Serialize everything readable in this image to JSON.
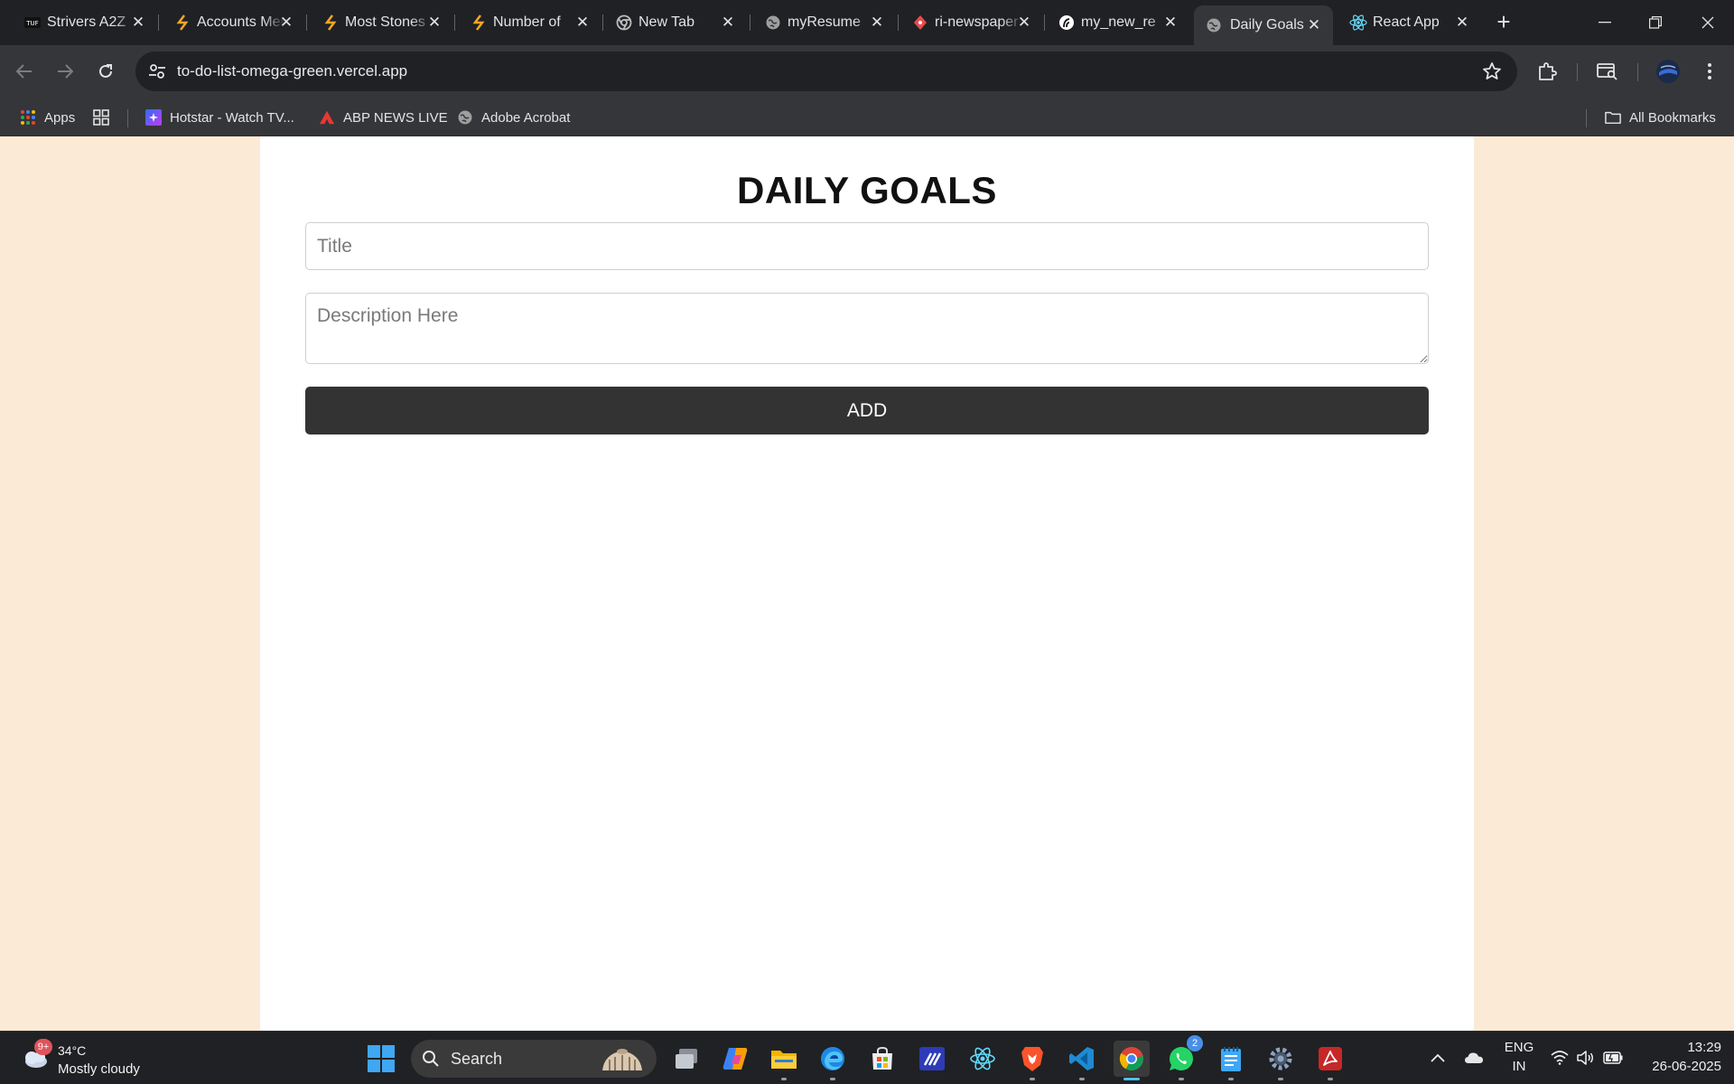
{
  "browser": {
    "tabs": [
      {
        "title": "Strivers A2Z",
        "icon": "tuf-icon"
      },
      {
        "title": "Accounts Merge",
        "icon": "code-icon"
      },
      {
        "title": "Most Stones",
        "icon": "code-icon"
      },
      {
        "title": "Number of",
        "icon": "code-icon"
      },
      {
        "title": "New Tab",
        "icon": "chrome-icon"
      },
      {
        "title": "myResume",
        "icon": "globe-icon"
      },
      {
        "title": "ri-newspaper",
        "icon": "git-icon"
      },
      {
        "title": "my_new_re",
        "icon": "render-icon"
      },
      {
        "title": "Daily Goals",
        "icon": "globe-icon",
        "active": true
      },
      {
        "title": "React App",
        "icon": "react-icon"
      }
    ],
    "url": "to-do-list-omega-green.vercel.app",
    "bookmarks": [
      {
        "label": "Apps",
        "icon": "apps-grid-icon"
      },
      {
        "label": "",
        "icon": "tab-groups-icon"
      },
      {
        "label": "Hotstar - Watch TV...",
        "icon": "hotstar-icon"
      },
      {
        "label": "ABP NEWS LIVE",
        "icon": "abp-icon"
      },
      {
        "label": "Adobe Acrobat",
        "icon": "globe-icon"
      }
    ],
    "all_bookmarks_label": "All Bookmarks"
  },
  "app": {
    "title": "DAILY GOALS",
    "title_placeholder": "Title",
    "description_placeholder": "Description Here",
    "add_label": "ADD"
  },
  "taskbar": {
    "weather_badge": "9+",
    "temperature": "34°C",
    "condition": "Mostly cloudy",
    "search_label": "Search",
    "whatsapp_badge": "2",
    "lang_top": "ENG",
    "lang_bottom": "IN",
    "time": "13:29",
    "date": "26-06-2025"
  },
  "colors": {
    "page_background": "#fbebd6",
    "card_background": "#ffffff",
    "button_background": "#333333",
    "browser_chrome": "#35363a"
  }
}
